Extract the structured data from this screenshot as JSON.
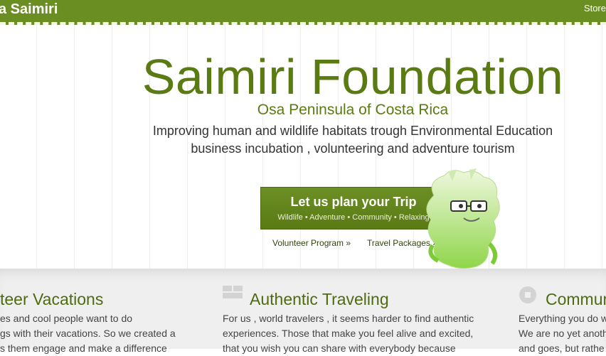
{
  "topbar": {
    "brand": "a Saimiri",
    "store": "Store"
  },
  "hero": {
    "title": "Saimiri Foundation",
    "subtitle": "Osa Peninsula of Costa Rica",
    "desc_line1": "Improving human and wildlife habitats trough Environmental Education",
    "desc_line2": "business incubation , volunteering and adventure tourism"
  },
  "cta": {
    "label": "Let us plan your Trip",
    "sub": "Wildlife • Adventure • Community • Relaxing"
  },
  "links": {
    "volunteer": "Volunteer Program »",
    "travel": "Travel Packages »"
  },
  "features": [
    {
      "title": "teer Vacations",
      "lines": [
        "es and cool people want to do",
        "gs with their vacations. So we created a",
        "s them engage and make a difference"
      ]
    },
    {
      "title": "Authentic Traveling",
      "lines": [
        "For us , world travelers , it seems harder to find authentic",
        "experiences. Those that make you feel alive and excited,",
        "that you wish you can share with everybody because"
      ]
    },
    {
      "title": "Commun",
      "lines": [
        "Everything you do w",
        "We are no yet anoth",
        "and goes, but rathe"
      ]
    }
  ],
  "colors": {
    "brand_green": "#6b8e23",
    "text_green": "#5a7a12"
  }
}
